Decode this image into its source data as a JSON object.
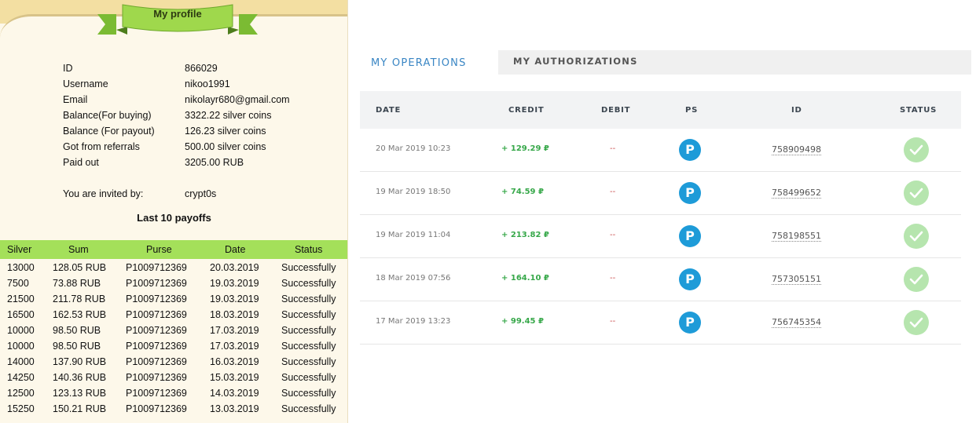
{
  "profile": {
    "title": "My profile",
    "rows": [
      {
        "label": "ID",
        "value": "866029"
      },
      {
        "label": "Username",
        "value": "nikoo1991"
      },
      {
        "label": "Email",
        "value": "nikolayr680@gmail.com"
      },
      {
        "label": "Balance(For buying)",
        "value": "3322.22 silver coins"
      },
      {
        "label": "Balance (For payout)",
        "value": "126.23 silver coins"
      },
      {
        "label": "Got from referrals",
        "value": "500.00 silver coins"
      },
      {
        "label": "Paid out",
        "value": "3205.00 RUB"
      }
    ],
    "invited_label": "You are invited by:",
    "invited_value": "crypt0s"
  },
  "payoffs": {
    "title": "Last 10 payoffs",
    "columns": [
      "Silver",
      "Sum",
      "Purse",
      "Date",
      "Status"
    ],
    "rows": [
      [
        "13000",
        "128.05 RUB",
        "P1009712369",
        "20.03.2019",
        "Successfully"
      ],
      [
        "7500",
        "73.88 RUB",
        "P1009712369",
        "19.03.2019",
        "Successfully"
      ],
      [
        "21500",
        "211.78 RUB",
        "P1009712369",
        "19.03.2019",
        "Successfully"
      ],
      [
        "16500",
        "162.53 RUB",
        "P1009712369",
        "18.03.2019",
        "Successfully"
      ],
      [
        "10000",
        "98.50 RUB",
        "P1009712369",
        "17.03.2019",
        "Successfully"
      ],
      [
        "10000",
        "98.50 RUB",
        "P1009712369",
        "17.03.2019",
        "Successfully"
      ],
      [
        "14000",
        "137.90 RUB",
        "P1009712369",
        "16.03.2019",
        "Successfully"
      ],
      [
        "14250",
        "140.36 RUB",
        "P1009712369",
        "15.03.2019",
        "Successfully"
      ],
      [
        "12500",
        "123.13 RUB",
        "P1009712369",
        "14.03.2019",
        "Successfully"
      ],
      [
        "15250",
        "150.21 RUB",
        "P1009712369",
        "13.03.2019",
        "Successfully"
      ]
    ]
  },
  "operations": {
    "tabs": [
      {
        "label": "MY OPERATIONS",
        "active": true
      },
      {
        "label": "MY AUTHORIZATIONS",
        "active": false
      }
    ],
    "columns": [
      "DATE",
      "CREDIT",
      "DEBIT",
      "PS",
      "ID",
      "STATUS"
    ],
    "rows": [
      {
        "date": "20 Mar 2019 10:23",
        "credit": "+ 129.29 ₽",
        "debit": "--",
        "ps": "P",
        "id": "758909498",
        "status": "success-check-icon"
      },
      {
        "date": "19 Mar 2019 18:50",
        "credit": "+ 74.59 ₽",
        "debit": "--",
        "ps": "P",
        "id": "758499652",
        "status": "success-check-icon"
      },
      {
        "date": "19 Mar 2019 11:04",
        "credit": "+ 213.82 ₽",
        "debit": "--",
        "ps": "P",
        "id": "758198551",
        "status": "success-check-icon"
      },
      {
        "date": "18 Mar 2019 07:56",
        "credit": "+ 164.10 ₽",
        "debit": "--",
        "ps": "P",
        "id": "757305151",
        "status": "success-check-icon"
      },
      {
        "date": "17 Mar 2019 13:23",
        "credit": "+ 99.45 ₽",
        "debit": "--",
        "ps": "P",
        "id": "756745354",
        "status": "success-check-icon"
      }
    ]
  },
  "colors": {
    "ribbon_green": "#9fd84c",
    "table_header_green": "#a4e05a",
    "active_tab_blue": "#3a86c4",
    "credit_green": "#37a84a",
    "ps_blue": "#1e9bd8",
    "status_green": "#b6e5ae"
  }
}
